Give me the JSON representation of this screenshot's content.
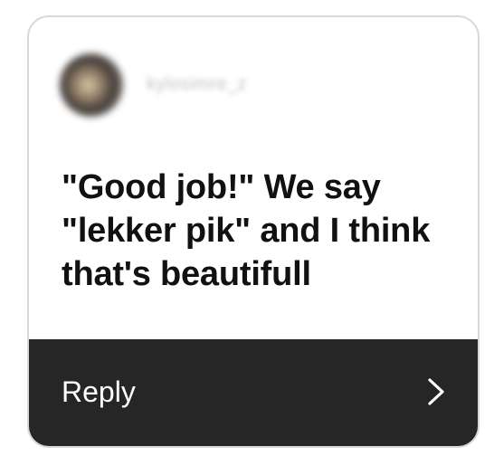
{
  "sender": {
    "username": "kylosimre_z",
    "avatar_icon": "profile-avatar-icon"
  },
  "message": {
    "text": "\"Good job!\" We say \"lekker pik\" and I think that's beautifull"
  },
  "reply": {
    "label": "Reply",
    "icon": "chevron-right-icon"
  },
  "colors": {
    "card_border": "#d9d9d9",
    "reply_background": "#262626",
    "message_text": "#111111",
    "reply_text": "#ffffff"
  }
}
